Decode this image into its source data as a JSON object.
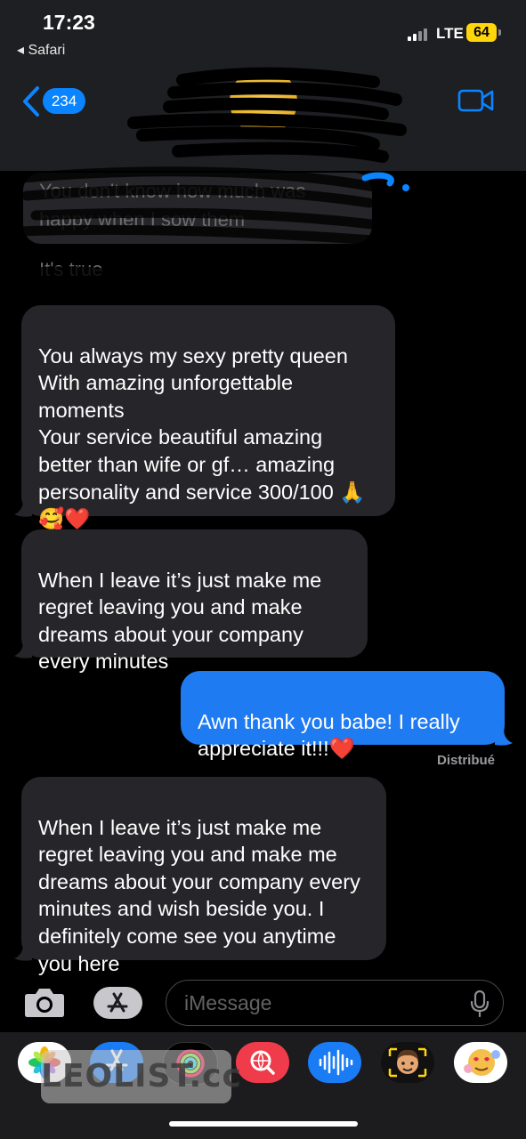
{
  "status_bar": {
    "time": "17:23",
    "back_app": "◂ Safari",
    "network": "LTE",
    "battery": "64"
  },
  "nav": {
    "back_count": "234"
  },
  "messages": [
    {
      "type": "incoming",
      "redacted": true,
      "text": "You don't know how much was"
    },
    {
      "type": "incoming",
      "redacted": true,
      "text": "happy when I sow them"
    },
    {
      "type": "incoming",
      "redacted": true,
      "text": "It's true"
    },
    {
      "type": "incoming",
      "text": "You always my sexy pretty queen\nWith amazing unforgettable moments\nYour service beautiful amazing better than wife or gf… amazing personality and service 300/100 🙏🥰❤️"
    },
    {
      "type": "incoming",
      "text": "When I leave it’s just make me regret leaving you and make dreams about your company every minutes"
    },
    {
      "type": "outgoing",
      "text": "Awn thank you babe! I really appreciate it!!!❤️"
    },
    {
      "type": "incoming",
      "text": "When I leave it’s just make me regret leaving you and make me dreams about your company every minutes and wish beside you. I definitely come see you anytime you here"
    }
  ],
  "delivery_status": "Distribué",
  "composer": {
    "placeholder": "iMessage"
  },
  "app_drawer": [
    "photos-app",
    "app-store-app",
    "activity-app",
    "web-images-app",
    "audio-message-app",
    "memoji-app",
    "animoji-app"
  ],
  "watermark": "LEOLIST.cc",
  "colors": {
    "accent": "#0a84ff",
    "outgoing_bubble": "#1f7bf2",
    "incoming_bubble": "#26252a",
    "battery": "#ffd60a"
  }
}
